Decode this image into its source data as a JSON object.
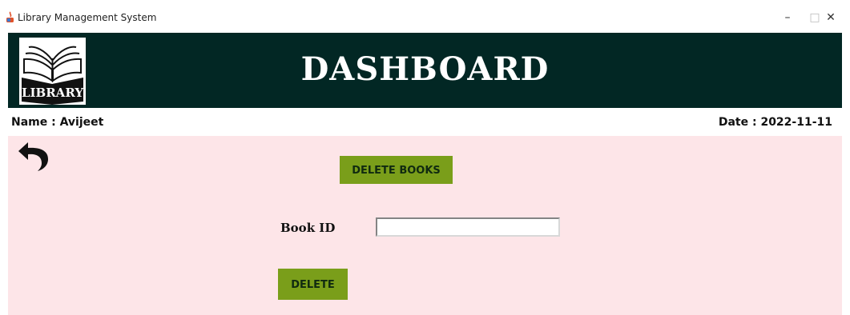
{
  "window": {
    "title": "Library Management System",
    "minimize_glyph": "–",
    "maximize_glyph": "□",
    "close_glyph": "✕"
  },
  "header": {
    "title": "DASHBOARD",
    "logo_text": "LIBRARY",
    "background_color": "#022724"
  },
  "info": {
    "name_text": "Name : Avijeet",
    "date_text": "Date :  2022-11-11"
  },
  "main": {
    "background_color": "#fde5e8",
    "back_icon": "undo-arrow-icon",
    "delete_books_label": "DELETE BOOKS",
    "book_id_label": "Book ID",
    "book_id_value": "",
    "delete_label": "DELETE",
    "button_color": "#7a9e1a"
  }
}
